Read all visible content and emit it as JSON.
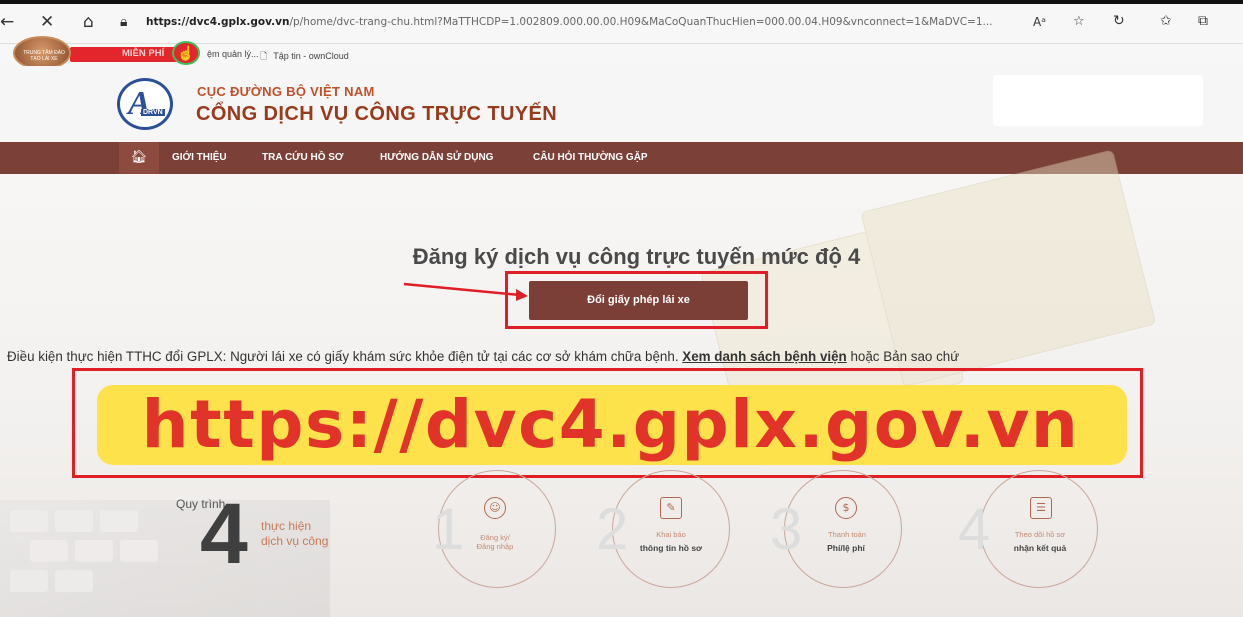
{
  "browser": {
    "url_domain": "https://dvc4.gplx.gov.vn",
    "url_rest": "/p/home/dvc-trang-chu.html?MaTTHCDP=1.002809.000.00.00.H09&MaCoQuanThucHien=000.00.04.H09&vnconnect=1&MaDVC=1...",
    "reader_label": "Aᵃ",
    "bookmarks": [
      {
        "label": "MIỄN PHÍ"
      },
      {
        "label": "ệm quản lý..."
      },
      {
        "label": "Tập tin - ownCloud"
      }
    ],
    "avatar_text": "TRUNG TÂM ĐÀO TẠO LÁI XE"
  },
  "header": {
    "logo_text": "DRVN",
    "org_name": "CỤC ĐƯỜNG BỘ VIỆT NAM",
    "portal_name": "CỔNG DỊCH VỤ CÔNG TRỰC TUYẾN"
  },
  "nav": {
    "items": [
      {
        "label": "GIỚI THIỆU"
      },
      {
        "label": "TRA CỨU HỒ SƠ"
      },
      {
        "label": "HƯỚNG DẪN SỬ DỤNG"
      },
      {
        "label": "CÂU HỎI THƯỜNG GẶP"
      }
    ]
  },
  "hero": {
    "heading": "Đăng ký dịch vụ công trực tuyến mức độ 4",
    "cta_label": "Đổi giấy phép lái xe",
    "condition_text": "Điều kiện thực hiện TTHC đổi GPLX: Người lái xe có giấy khám sức khỏe điện tử tại các cơ sở khám chữa bệnh. ",
    "condition_link": "Xem danh sách bệnh viện",
    "condition_tail": " hoặc Bản sao chứ",
    "banner_url": "https://dvc4.gplx.gov.vn"
  },
  "process": {
    "label": "Quy trình",
    "number": "4",
    "subtitle_1": "thực hiện",
    "subtitle_2": "dịch vụ công",
    "steps": [
      {
        "num": "1",
        "small": "Đăng ký/",
        "big": "Đăng nhập"
      },
      {
        "num": "2",
        "small": "Khai báo",
        "big": "thông tin hồ sơ"
      },
      {
        "num": "3",
        "small": "Thanh toán",
        "big": "Phí/lệ phí"
      },
      {
        "num": "4",
        "small": "Theo dõi hồ sơ",
        "big": "nhận kết quả"
      }
    ]
  },
  "colors": {
    "nav_bg": "#7b4138",
    "cta_bg": "#7b3f37",
    "highlight_red": "#e01e26",
    "banner_yellow": "#fde24c",
    "banner_text": "#e2332a"
  }
}
